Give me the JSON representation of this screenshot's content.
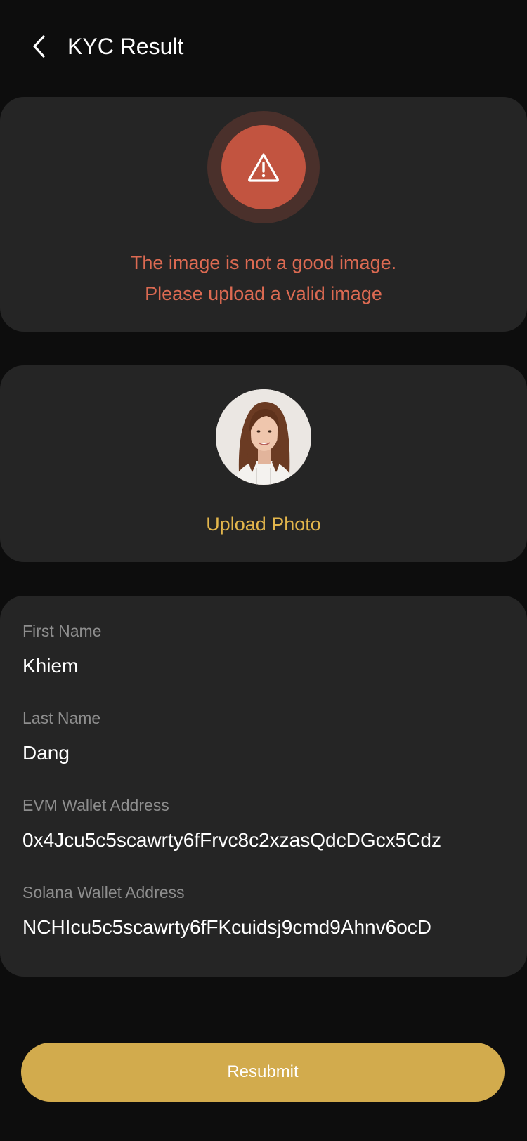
{
  "header": {
    "title": "KYC Result",
    "back_icon": "chevron-left-icon"
  },
  "kyc_error": {
    "icon": "warning-icon",
    "line_1": "The image is not a good image.",
    "line_2": "Please upload a valid image",
    "color": "#dc6a52"
  },
  "photo": {
    "upload_label": "Upload Photo",
    "accent_color": "#e3b64c"
  },
  "fields": [
    {
      "label": "First Name",
      "value": "Khiem"
    },
    {
      "label": "Last Name",
      "value": "Dang"
    },
    {
      "label": "EVM Wallet Address",
      "value": "0x4Jcu5c5scawrty6fFrvc8c2xzasQdcDGcx5Cdz"
    },
    {
      "label": "Solana Wallet Address",
      "value": "NCHIcu5c5scawrty6fFKcuidsj9cmd9Ahnv6ocD"
    }
  ],
  "actions": {
    "resubmit_label": "Resubmit",
    "button_color": "#d2ab4d"
  }
}
